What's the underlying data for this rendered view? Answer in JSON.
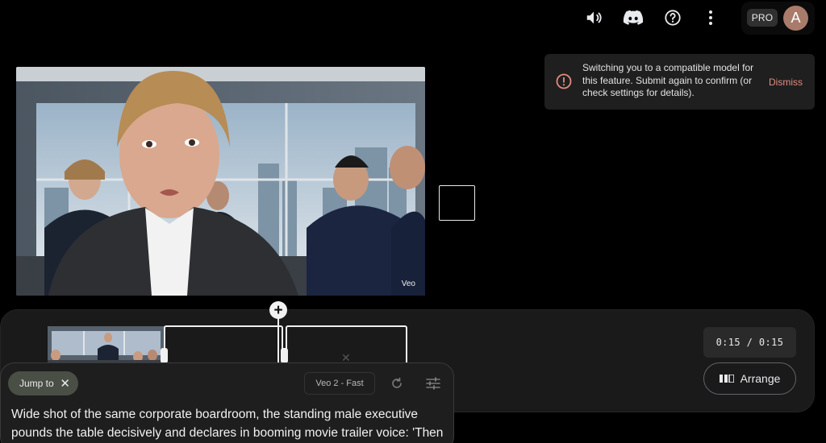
{
  "topbar": {
    "icons": [
      "volume-icon",
      "discord-icon",
      "help-icon",
      "more-vert-icon"
    ],
    "pro_badge": "PRO",
    "avatar_initial": "A"
  },
  "notification": {
    "message": "Switching you to a compatible model for this feature. Submit again to confirm (or check settings for details).",
    "dismiss_label": "Dismiss",
    "icon": "error-circle-icon",
    "accent_color": "#e48b81"
  },
  "preview": {
    "watermark": "Veo"
  },
  "timeline": {
    "add_clip_label": "+",
    "time_display": "0:15 / 0:15",
    "arrange_label": "Arrange"
  },
  "prompt_panel": {
    "jump_chip_label": "Jump to",
    "model_label": "Veo 2 - Fast",
    "prompt_text": "Wide shot of the same corporate boardroom, the standing male executive pounds the table decisively and declares in booming movie trailer voice: 'Then"
  },
  "colors": {
    "background": "#000000",
    "panel": "#1a1a1a",
    "avatar": "#a97b6b"
  }
}
